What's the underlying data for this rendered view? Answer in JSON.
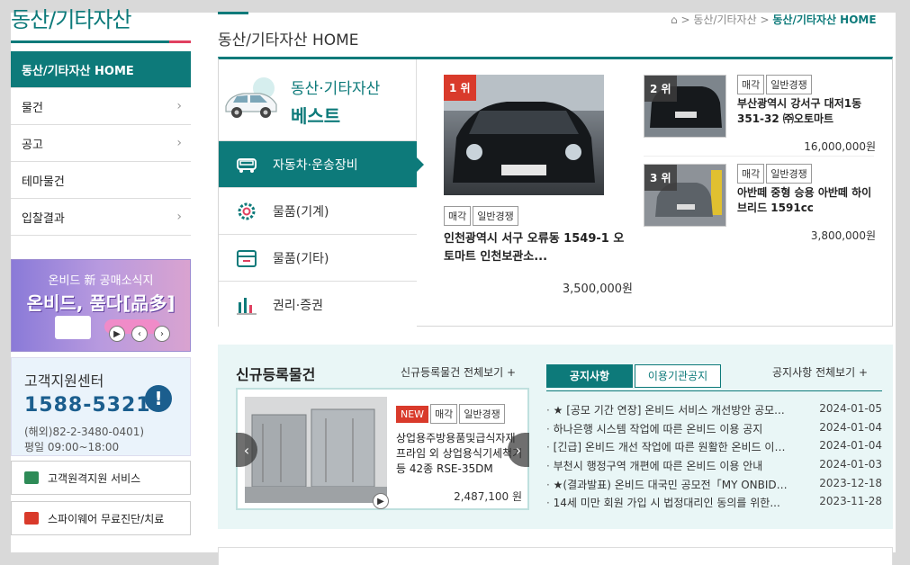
{
  "sidebar": {
    "title": "동산/기타자산",
    "items": [
      {
        "label": "동산/기타자산 HOME"
      },
      {
        "label": "물건"
      },
      {
        "label": "공고"
      },
      {
        "label": "테마물건"
      },
      {
        "label": "입찰결과"
      }
    ],
    "banner": {
      "top": "온비드 新 공매소식지",
      "main": "온비드, 품다[品多]"
    },
    "support": {
      "title": "고객지원센터",
      "phone": "1588-5321",
      "overseas": "(해외)82-2-3480-0401)",
      "hours": "평일 09:00~18:00"
    },
    "services": [
      {
        "label": "고객원격지원 서비스"
      },
      {
        "label": "스파이웨어 무료진단/치료"
      }
    ]
  },
  "breadcrumb": {
    "home_icon": "home-icon",
    "sep": ">",
    "level1": "동산/기타자산",
    "current": "동산/기타자산 HOME"
  },
  "main": {
    "title": "동산/기타자산 HOME",
    "best": {
      "title_top": "동산·기타자산",
      "title_bottom": "베스트",
      "categories": [
        {
          "label": "자동차·운송장비",
          "icon": "car-icon",
          "active": true
        },
        {
          "label": "물품(기계)",
          "icon": "gear-icon"
        },
        {
          "label": "물품(기타)",
          "icon": "box-icon"
        },
        {
          "label": "권리·증권",
          "icon": "bar-chart-icon"
        }
      ],
      "rank1": {
        "rank_num": "1",
        "rank_suffix": "위",
        "tags": [
          "매각",
          "일반경쟁"
        ],
        "title": "인천광역시 서구 오류동 1549-1 오토마트 인천보관소...",
        "price": "3,500,000원"
      },
      "rank2": {
        "rank_num": "2",
        "rank_suffix": "위",
        "tags": [
          "매각",
          "일반경쟁"
        ],
        "title": "부산광역시 강서구 대저1동 351-32 ㈜오토마트",
        "price": "16,000,000원"
      },
      "rank3": {
        "rank_num": "3",
        "rank_suffix": "위",
        "tags": [
          "매각",
          "일반경쟁"
        ],
        "title": "아반떼 중형 승용 아반떼 하이브리드 1591cc",
        "price": "3,800,000원"
      }
    },
    "new_items": {
      "title": "신규등록물건",
      "view_all": "신규등록물건 전체보기 +",
      "item": {
        "tags": [
          "NEW",
          "매각",
          "일반경쟁"
        ],
        "text": "상업용주방용품및급식자재 프라임 외 상업용식기세척기 등 42종 RSE-35DM",
        "price": "2,487,100 원"
      }
    },
    "notices": {
      "tabs": [
        "공지사항",
        "이용기관공지"
      ],
      "view_all": "공지사항 전체보기 +",
      "rows": [
        {
          "title": "★ [공모 기간 연장] 온비드 서비스 개선방안 공모...",
          "date": "2024-01-05"
        },
        {
          "title": "하나은행 시스템 작업에 따른 온비드 이용 공지",
          "date": "2024-01-04"
        },
        {
          "title": "[긴급] 온비드 개선 작업에 따른 원활한 온비드 이용...",
          "date": "2024-01-04"
        },
        {
          "title": "부천시 행정구역 개편에 따른 온비드 이용 안내",
          "date": "2024-01-03"
        },
        {
          "title": "★(결과발표) 온비드 대국민 공모전「MY ONBID」...",
          "date": "2023-12-18"
        },
        {
          "title": "14세 미만 회원 가입 시 법정대리인 동의를 위한...",
          "date": "2023-11-28"
        }
      ]
    }
  },
  "colors": {
    "accent": "#0d7a7a",
    "rank_badge": "#d93a2b",
    "new_badge": "#d93a2b",
    "support_phone": "#1b5e8e"
  }
}
